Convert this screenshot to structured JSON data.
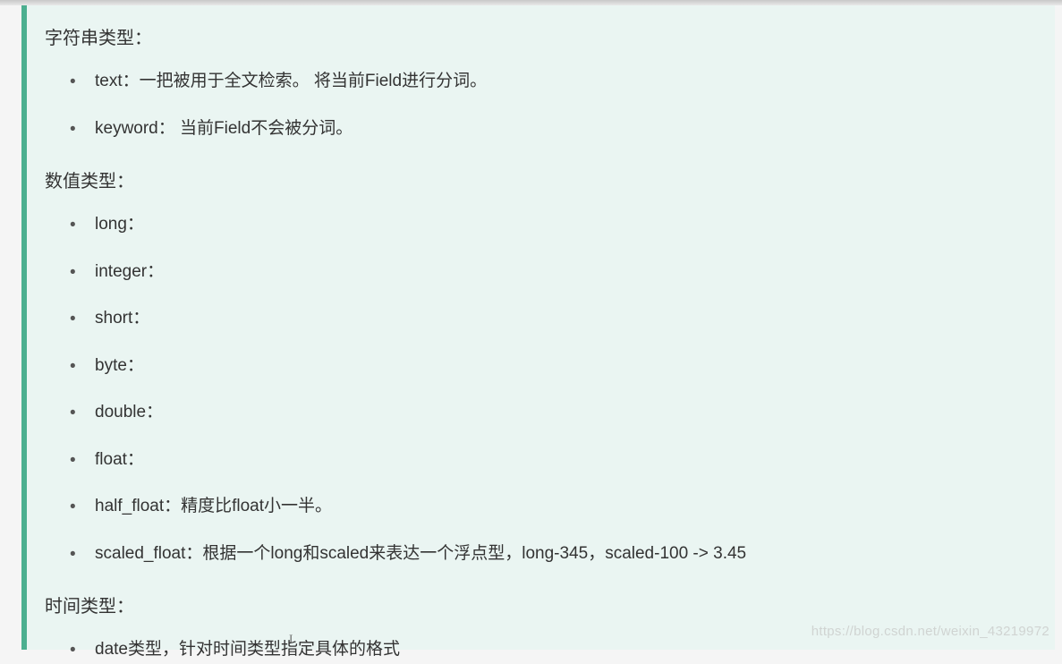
{
  "sections": [
    {
      "heading": "字符串类型：",
      "items": [
        "text：一把被用于全文检索。 将当前Field进行分词。",
        "keyword： 当前Field不会被分词。"
      ]
    },
    {
      "heading": "数值类型：",
      "items": [
        "long：",
        "integer：",
        "short：",
        "byte：",
        "double：",
        "float：",
        "half_float：精度比float小一半。",
        "scaled_float：根据一个long和scaled来表达一个浮点型，long-345，scaled-100 -> 3.45"
      ]
    },
    {
      "heading": "时间类型：",
      "items": [
        "date类型，针对时间类型指定具体的格式"
      ]
    }
  ],
  "watermark": "https://blog.csdn.net/weixin_43219972"
}
